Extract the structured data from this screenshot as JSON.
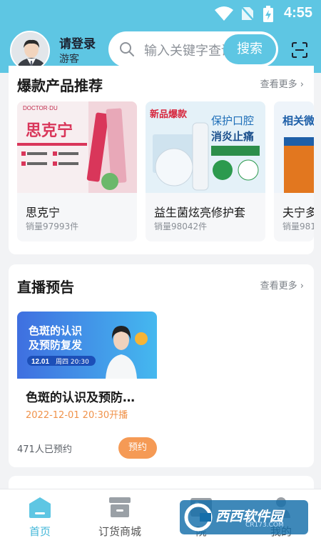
{
  "status_bar": {
    "time": "4:55"
  },
  "header": {
    "login_title": "请登录",
    "login_subtitle": "游客",
    "search_placeholder": "输入关键字查询",
    "search_button": "搜索"
  },
  "hot_products": {
    "title": "爆款产品推荐",
    "more": "查看更多",
    "items": [
      {
        "name": "思克宁",
        "sales": "销量97993件",
        "image_brand": "DOCTOR·DU",
        "image_title": "思克宁"
      },
      {
        "name": "益生菌炫亮修护套",
        "sales": "销量98042件",
        "image_badge": "新品爆款",
        "image_title": "保护口腔",
        "image_subtitle": "消炎止痛"
      },
      {
        "name": "夫宁多",
        "sales": "销量981",
        "image_title": "相关微"
      }
    ]
  },
  "live_preview": {
    "title": "直播预告",
    "more": "查看更多",
    "card": {
      "image_text_1": "色斑的认识",
      "image_text_2": "及预防复发",
      "image_date": "12.01",
      "image_weekday": "周四 20:30",
      "title": "色斑的认识及预防…",
      "time": "2022-12-01 20:30开播",
      "count": "471人已预约",
      "reserve_button": "预约"
    }
  },
  "tabbar": {
    "items": [
      {
        "label": "首页",
        "active": true
      },
      {
        "label": "订货商城",
        "active": false
      },
      {
        "label": "院",
        "active": false
      },
      {
        "label": "我的",
        "active": false
      }
    ]
  },
  "watermark": {
    "text": "西西软件园",
    "url": "CR173.COM"
  },
  "colors": {
    "primary": "#5ec6e3",
    "accent_orange": "#f59a55",
    "tab_active": "#43b7d8"
  }
}
